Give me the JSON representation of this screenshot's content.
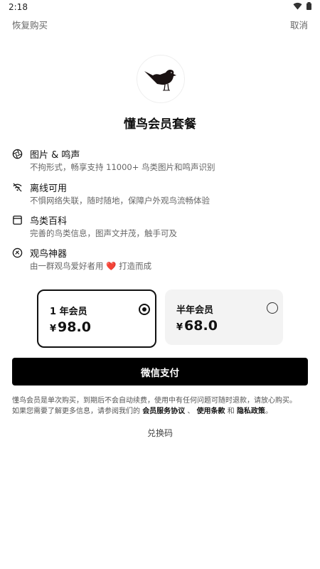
{
  "status_bar": {
    "time": "2:18"
  },
  "top_bar": {
    "restore_label": "恢复购买",
    "cancel_label": "取消"
  },
  "title": "懂鸟会员套餐",
  "features": [
    {
      "icon": "aperture-icon",
      "title": "图片 & 鸣声",
      "desc": "不拘形式，畅享支持 11000+ 鸟类图片和鸣声识别"
    },
    {
      "icon": "wifi-off-icon",
      "title": "离线可用",
      "desc": "不惧网络失联，随时随地，保障户外观鸟流畅体验"
    },
    {
      "icon": "book-icon",
      "title": "鸟类百科",
      "desc": "完善的鸟类信息，图声文并茂，触手可及"
    },
    {
      "icon": "badge-icon",
      "title": "观鸟神器",
      "desc_before": "由一群观鸟爱好者用",
      "desc_heart": "❤️",
      "desc_after": "打造而成"
    }
  ],
  "plans": [
    {
      "name": "1 年会员",
      "currency": "¥",
      "price": "98.0",
      "selected": true
    },
    {
      "name": "半年会员",
      "currency": "¥",
      "price": "68.0",
      "selected": false
    }
  ],
  "pay_button": "微信支付",
  "terms": {
    "line1": "懂鸟会员是单次购买，到期后不会自动续费，使用中有任何问题可随时退款，请放心购买。",
    "line2_prefix": "如果您需要了解更多信息，请参阅我们的",
    "link1": "会员服务协议",
    "sep1": "、",
    "link2": "使用条款",
    "sep2": "和",
    "link3": "隐私政策",
    "end": "。"
  },
  "redeem": "兑换码",
  "colors": {
    "primary": "#000000",
    "heart": "#e02424",
    "plan_unselected_bg": "#f3f3f3"
  }
}
